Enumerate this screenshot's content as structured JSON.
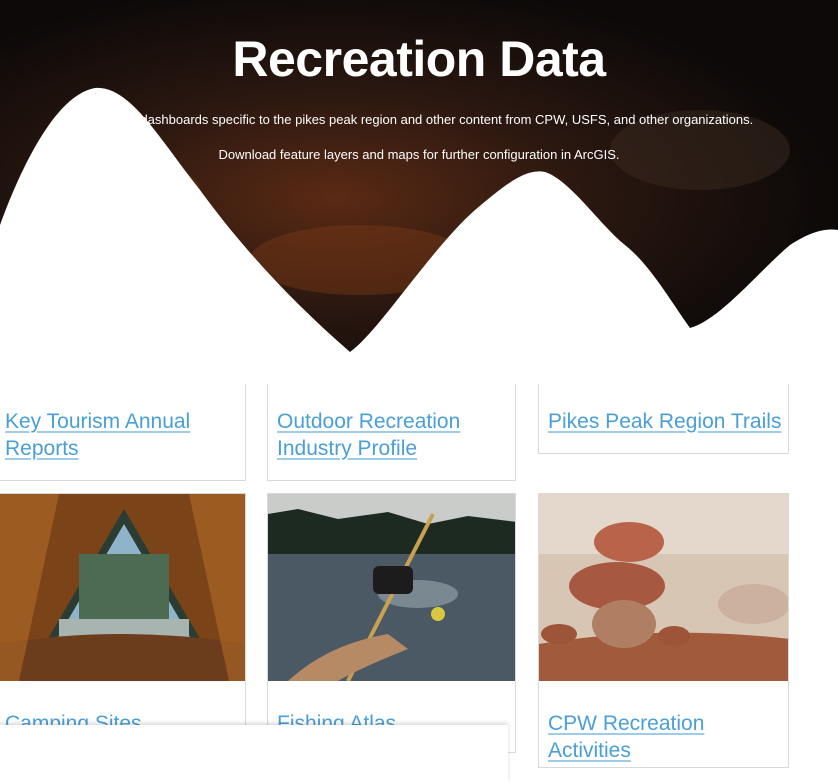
{
  "hero": {
    "title": "Recreation Data",
    "subtitle_line1": "Explore dashboards specific to the pikes peak region and other content from CPW, USFS, and other organizations.",
    "subtitle_line2": "Download feature layers and maps for further configuration in ArcGIS."
  },
  "cards": [
    {
      "label": "Key Tourism Annual Reports"
    },
    {
      "label": "Outdoor Recreation Industry Profile"
    },
    {
      "label": "Pikes Peak Region Trails"
    },
    {
      "label": "Camping Sites"
    },
    {
      "label": "Fishing Atlas"
    },
    {
      "label": "CPW Recreation Activities"
    }
  ],
  "colors": {
    "link": "#4a9fd6",
    "hero_dark": "#1a120e"
  }
}
